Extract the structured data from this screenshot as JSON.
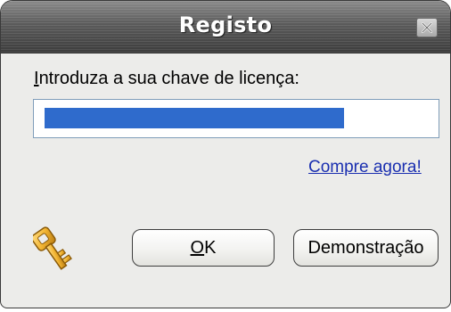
{
  "dialog": {
    "title": "Registo",
    "prompt_first_letter": "I",
    "prompt_rest": "ntroduza a sua chave de licença:",
    "license_key_value": "",
    "buy_now_link": "Compre agora!",
    "ok_button_mnemonic": "O",
    "ok_button_rest": "K",
    "demo_button": "Demonstração"
  },
  "icons": {
    "close": "close-icon",
    "key": "key-icon"
  },
  "colors": {
    "titlebar": "#5a5a5a",
    "selection": "#2f6bcc",
    "link": "#1a2fb0",
    "key_gold": "#f2b431"
  }
}
